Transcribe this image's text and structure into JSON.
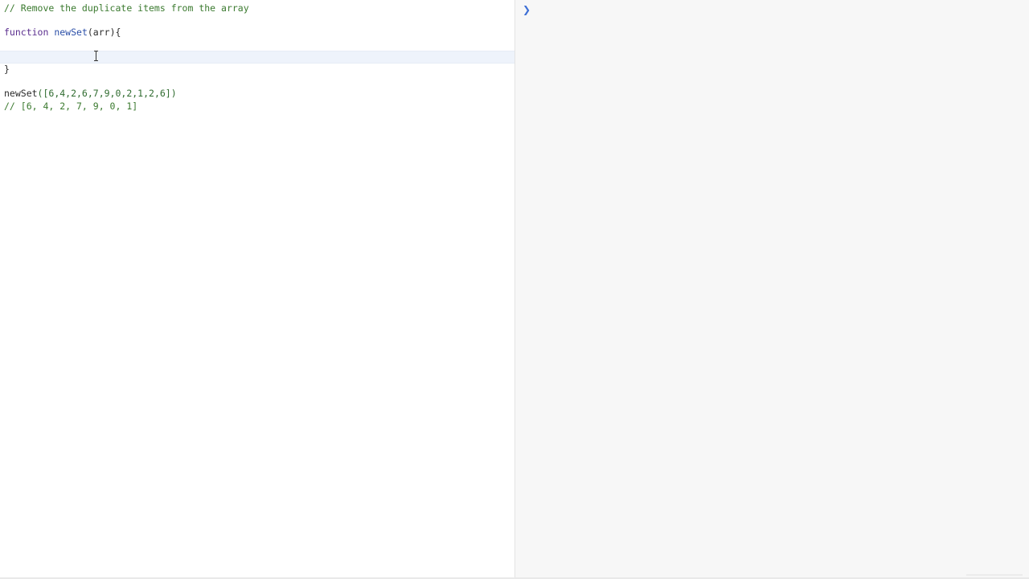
{
  "editor": {
    "lines": {
      "l1": "// Remove the duplicate items from the array",
      "l3_kw": "function",
      "l3_fn": "newSet",
      "l3_rest": "(arr){",
      "l4": "",
      "l5": "}",
      "l7_fn": "newSet",
      "l7_rest": "([6,4,2,6,7,9,0,2,1,2,6])",
      "l8": "// [6, 4, 2, 7, 9, 0, 1]"
    }
  },
  "console": {
    "prompt": "❯",
    "input_value": ""
  },
  "colors": {
    "comment": "#3b7a2f",
    "keyword": "#5a2d8e",
    "function_name": "#2b4fa8",
    "active_line": "#eef3fb",
    "console_bg": "#f7f7f7",
    "prompt": "#3d6fd6"
  },
  "icons": {
    "prompt": "chevron-right-icon",
    "cursor": "text-cursor-icon"
  }
}
